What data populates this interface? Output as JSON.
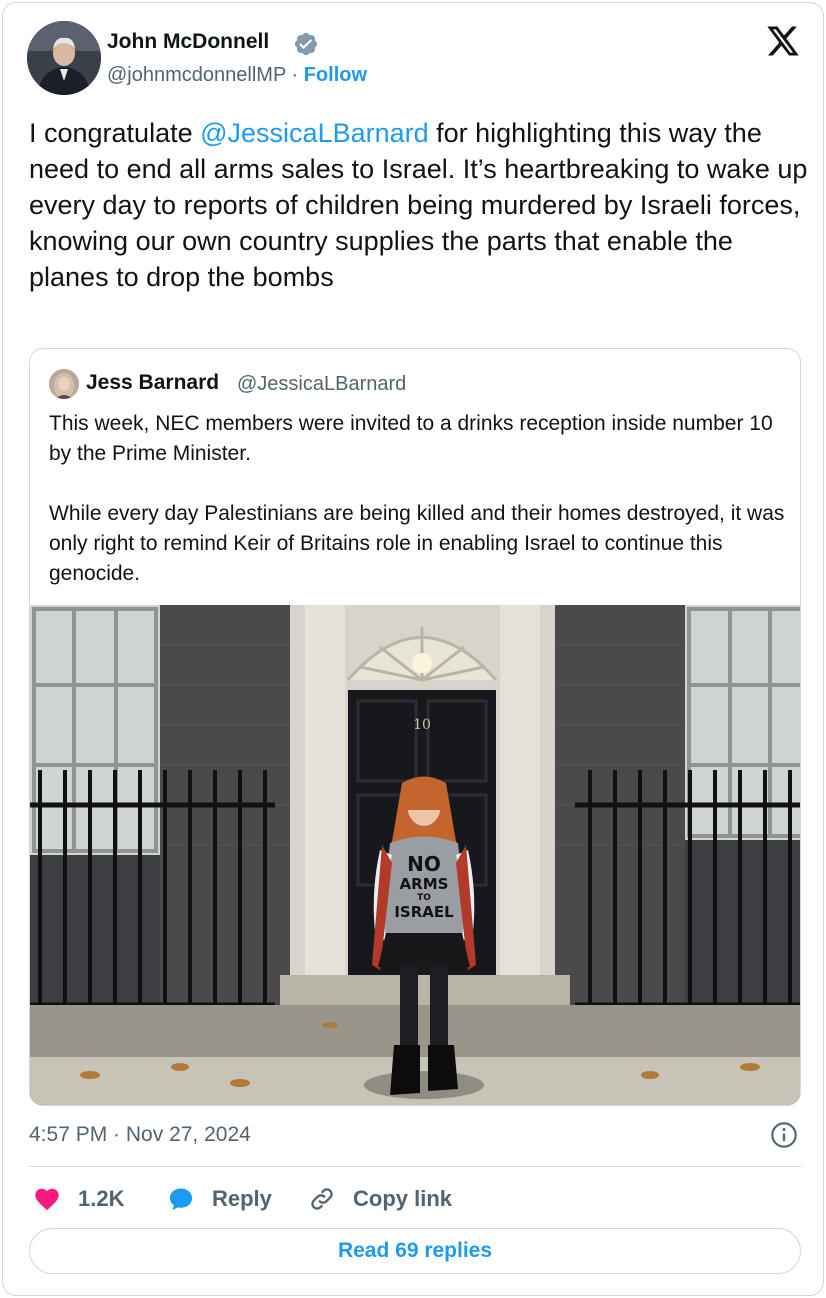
{
  "author": {
    "name": "John McDonnell",
    "handle": "@johnmcdonnellMP",
    "separator": " · ",
    "follow_label": "Follow",
    "verified": true
  },
  "tweet": {
    "text_before": "I congratulate ",
    "mention": "@JessicaLBarnard",
    "text_after": " for highlighting this way the need to end all arms sales to Israel. It’s heartbreaking to wake up every day to reports of children being murdered by Israeli forces, knowing our own country supplies the parts that enable the planes to drop the bombs"
  },
  "quote": {
    "name": "Jess Barnard",
    "handle": "@JessicaLBarnard",
    "paragraphs": [
      "This week, NEC members were invited to a drinks reception inside number 10 by the Prime Minister.",
      "While every day Palestinians are being killed and their homes destroyed, it was only right to remind Keir of Britains role in enabling Israel to continue this genocide."
    ],
    "image": {
      "door_number": "10",
      "shirt_text_line1": "NO",
      "shirt_text_line2": "ARMS",
      "shirt_text_line3": "TO",
      "shirt_text_line4": "ISRAEL"
    }
  },
  "meta": {
    "time": "4:57 PM",
    "separator": " · ",
    "date": "Nov 27, 2024"
  },
  "actions": {
    "likes": "1.2K",
    "reply_label": "Reply",
    "copy_label": "Copy link"
  },
  "read_replies_label": "Read 69 replies",
  "colors": {
    "accent": "#1d9bf0",
    "like": "#f91880",
    "text": "#0f1419",
    "muted": "#536471",
    "border": "#cfd9de"
  }
}
